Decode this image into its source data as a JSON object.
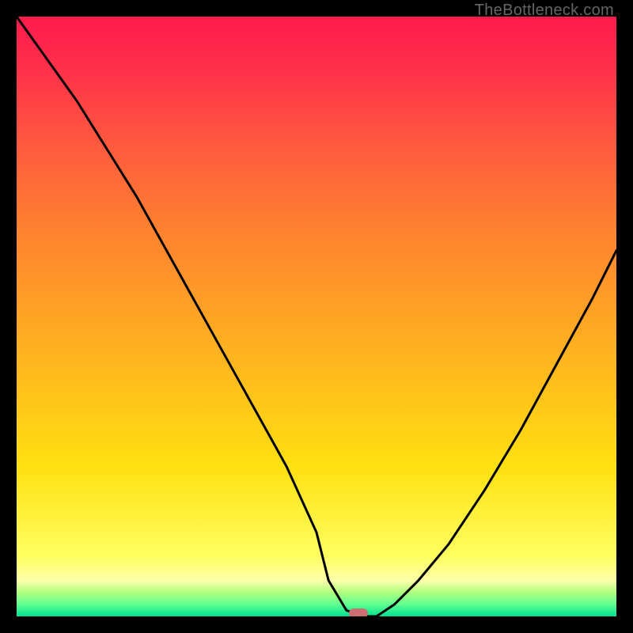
{
  "watermark": "TheBottleneck.com",
  "chart_data": {
    "type": "line",
    "title": "",
    "xlabel": "",
    "ylabel": "",
    "xlim": [
      0,
      100
    ],
    "ylim": [
      0,
      100
    ],
    "background_gradient": {
      "top": "#ff1a4d",
      "middle": "#ffe010",
      "bottom": "#00e090"
    },
    "series": [
      {
        "name": "bottleneck-curve",
        "color": "#000000",
        "x": [
          0,
          5,
          10,
          15,
          20,
          25,
          30,
          35,
          40,
          45,
          50,
          52,
          55,
          58,
          60,
          63,
          67,
          72,
          78,
          84,
          90,
          96,
          100
        ],
        "values": [
          100,
          93,
          86,
          78,
          70,
          61,
          52,
          43,
          34,
          25,
          14,
          6,
          1,
          0,
          0,
          2,
          6,
          12,
          21,
          31,
          42,
          53,
          61
        ]
      }
    ],
    "marker": {
      "name": "optimal-point",
      "x": 57,
      "y": 0.5,
      "color": "#cc6e72"
    }
  }
}
